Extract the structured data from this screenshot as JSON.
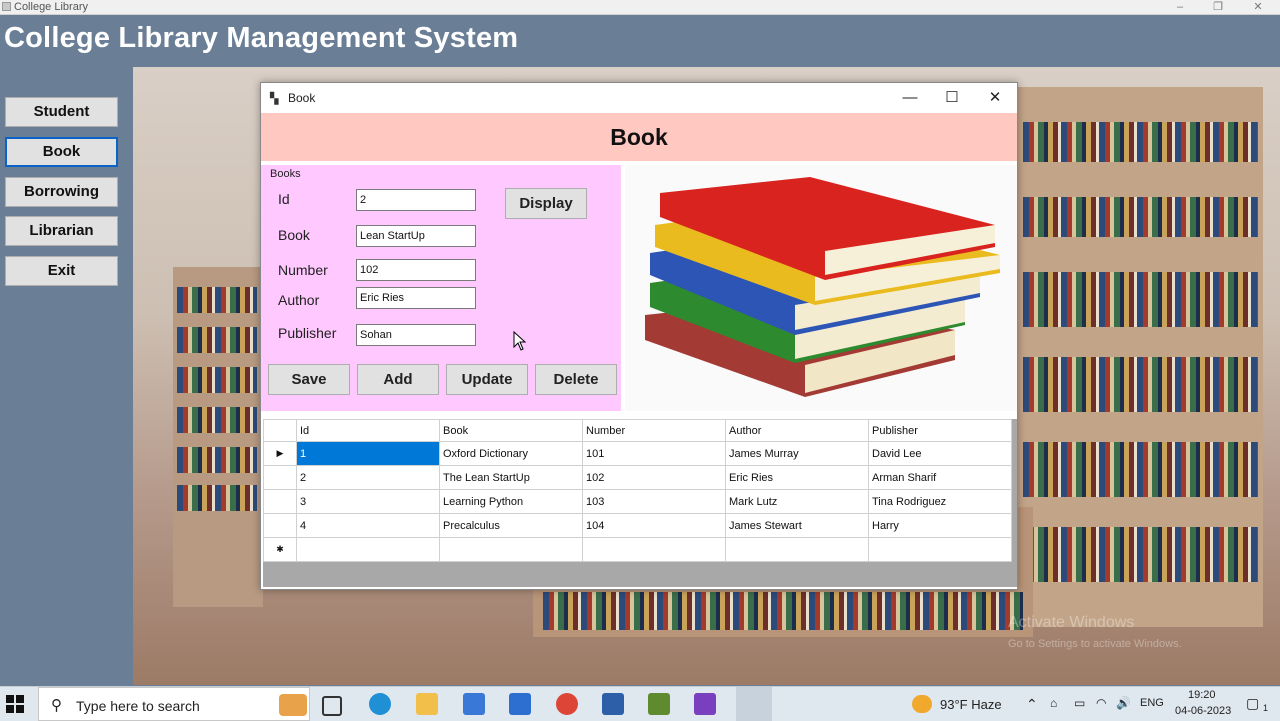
{
  "outer_window": {
    "title": "College Library",
    "minimize": "–",
    "maximize": "❐",
    "close": "✕"
  },
  "main_title": "College Library Management System",
  "nav": [
    {
      "label": "Student"
    },
    {
      "label": "Book"
    },
    {
      "label": "Borrowing"
    },
    {
      "label": "Librarian"
    },
    {
      "label": "Exit"
    }
  ],
  "book_window": {
    "title": "Book",
    "header": "Book",
    "minimize": "—",
    "maximize": "☐",
    "close": "✕",
    "group_label": "Books",
    "fields": {
      "id": {
        "label": "Id",
        "value": "2"
      },
      "book": {
        "label": "Book",
        "value": "Lean StartUp"
      },
      "number": {
        "label": "Number",
        "value": "102"
      },
      "author": {
        "label": "Author",
        "value": "Eric Ries"
      },
      "publisher": {
        "label": "Publisher",
        "value": "Sohan"
      }
    },
    "buttons": {
      "display": "Display",
      "save": "Save",
      "add": "Add",
      "update": "Update",
      "delete": "Delete"
    },
    "grid": {
      "columns": [
        "Id",
        "Book",
        "Number",
        "Author",
        "Publisher"
      ],
      "rows": [
        [
          "1",
          "Oxford Dictionary",
          "101",
          "James Murray",
          "David Lee"
        ],
        [
          "2",
          "The Lean StartUp",
          "102",
          "Eric Ries",
          "Arman Sharif"
        ],
        [
          "3",
          "Learning Python",
          "103",
          "Mark Lutz",
          "Tina Rodriguez"
        ],
        [
          "4",
          "Precalculus",
          "104",
          "James Stewart",
          "Harry"
        ]
      ],
      "current_row_marker": "▶",
      "new_row_marker": "✱"
    }
  },
  "watermark": {
    "line1": "Activate Windows",
    "line2": "Go to Settings to activate Windows."
  },
  "taskbar": {
    "search_placeholder": "Type here to search",
    "weather": "93°F  Haze",
    "language": "ENG",
    "time": "19:20",
    "date": "04-06-2023",
    "notification_count": "1"
  },
  "colors": {
    "header_pink": "#ffc8c0",
    "group_pink": "#ffc8ff",
    "selection_blue": "#0078d7",
    "app_background": "#6a7f96"
  }
}
